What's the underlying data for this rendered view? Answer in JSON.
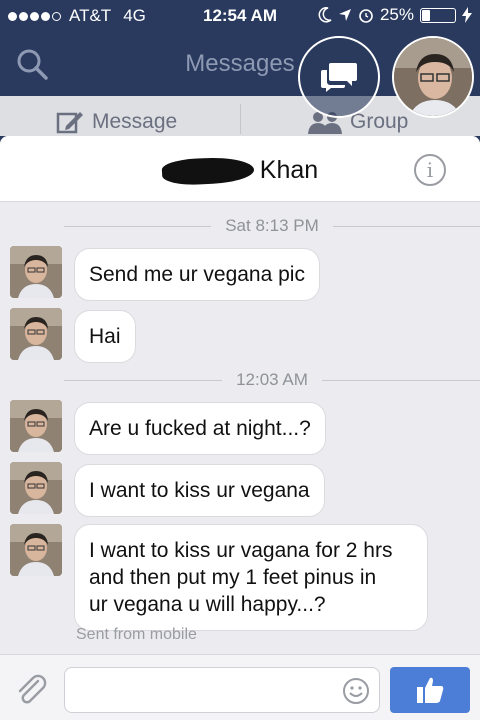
{
  "status_bar": {
    "carrier": "AT&T",
    "network": "4G",
    "time": "12:54 AM",
    "battery": "25%",
    "battery_level": 0.25
  },
  "header": {
    "title": "Messages"
  },
  "sub_header": {
    "message_label": "Message",
    "group_label": "Group"
  },
  "chat": {
    "contact_name": "Khan",
    "groups": [
      {
        "timestamp": "Sat 8:13 PM",
        "messages": [
          "Send me ur vegana pic",
          "Hai"
        ]
      },
      {
        "timestamp": "12:03 AM",
        "messages": [
          "Are u fucked at night...?",
          "I want to kiss ur vegana",
          [
            "I want to kiss ur vagana for 2 hrs",
            "and then put my 1 feet pinus in",
            "ur vegana u will happy...?"
          ]
        ]
      }
    ],
    "sent_from": "Sent from mobile"
  },
  "composer": {
    "placeholder": ""
  },
  "colors": {
    "nav_bg": "#2a3a5e",
    "chat_bg": "#ececf0",
    "like_button": "#4d7ed7"
  },
  "icons": {
    "search": "search-icon",
    "new_chat": "chat-bubbles-icon",
    "compose": "compose-icon",
    "group": "group-icon",
    "info": "info-icon",
    "attach": "paperclip-icon",
    "emoji": "smiley-icon",
    "like": "thumbs-up-icon",
    "alarm": "alarm-icon",
    "location": "location-arrow-icon",
    "moon": "moon-icon",
    "charging": "charging-bolt-icon"
  }
}
